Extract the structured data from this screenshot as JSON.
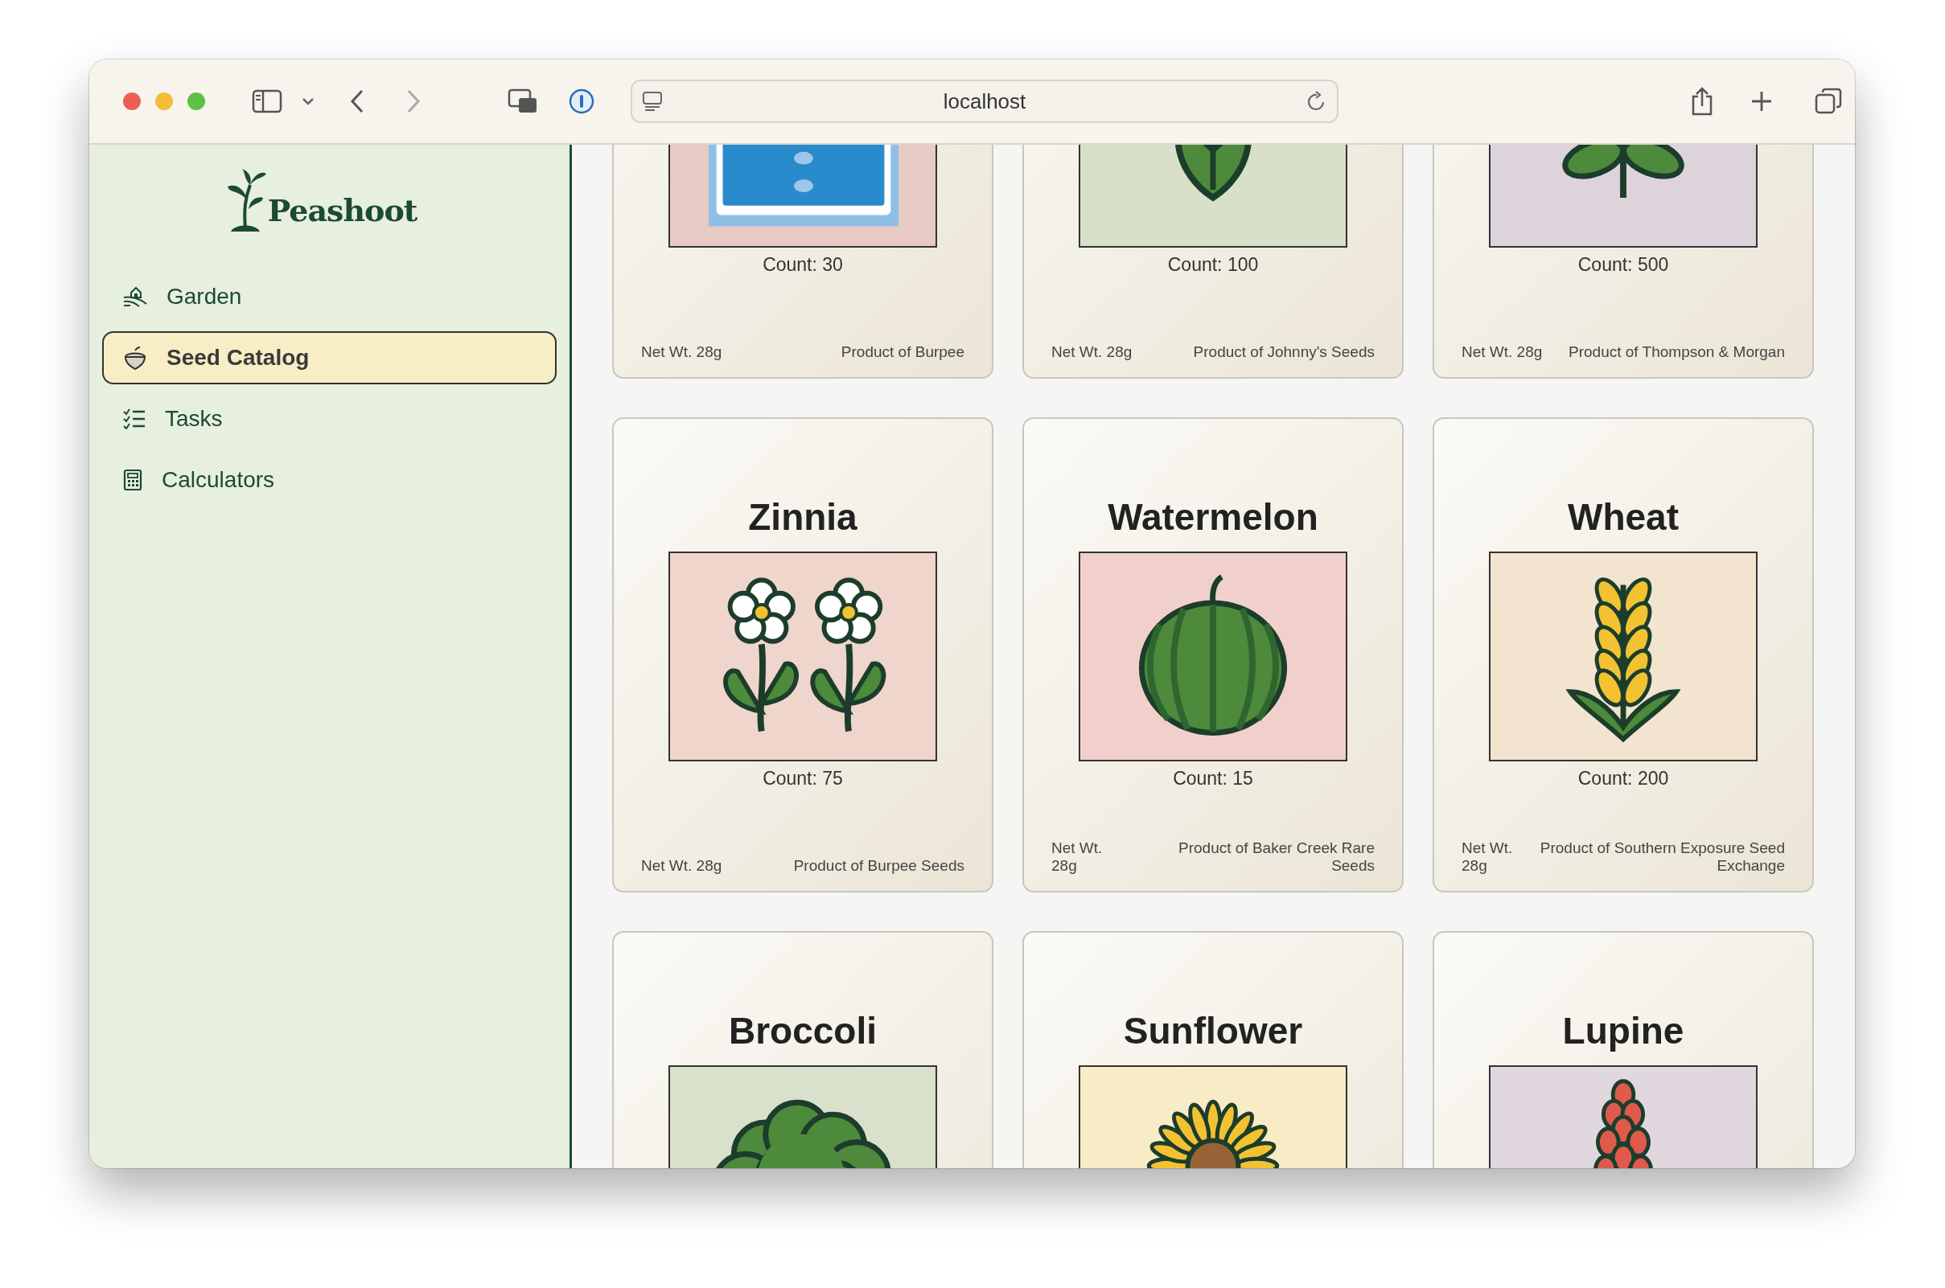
{
  "browser": {
    "address": "localhost"
  },
  "sidebar": {
    "logo": "Peashoot",
    "items": [
      {
        "label": "Garden",
        "selected": false
      },
      {
        "label": "Seed Catalog",
        "selected": true
      },
      {
        "label": "Tasks",
        "selected": false
      },
      {
        "label": "Calculators",
        "selected": false
      }
    ]
  },
  "packets": [
    {
      "kind": "pool",
      "count": "Count: 30",
      "net_weight": "Net Wt. 28g",
      "producer": "Product of Burpee"
    },
    {
      "kind": "leaf",
      "count": "Count: 100",
      "net_weight": "Net Wt. 28g",
      "producer": "Product of Johnny's Seeds"
    },
    {
      "kind": "sprig",
      "count": "Count: 500",
      "net_weight": "Net Wt. 28g",
      "producer": "Product of Thompson & Morgan"
    },
    {
      "kind": "zinnia",
      "name": "Zinnia",
      "count": "Count: 75",
      "net_weight": "Net Wt. 28g",
      "producer": "Product of Burpee Seeds"
    },
    {
      "kind": "watermelon",
      "name": "Watermelon",
      "count": "Count: 15",
      "net_weight": "Net Wt. 28g",
      "producer": "Product of Baker Creek Rare Seeds"
    },
    {
      "kind": "wheat",
      "name": "Wheat",
      "count": "Count: 200",
      "net_weight": "Net Wt. 28g",
      "producer": "Product of Southern Exposure Seed Exchange"
    },
    {
      "kind": "broccoli",
      "name": "Broccoli"
    },
    {
      "kind": "sunflower",
      "name": "Sunflower"
    },
    {
      "kind": "lupine",
      "name": "Lupine"
    }
  ]
}
